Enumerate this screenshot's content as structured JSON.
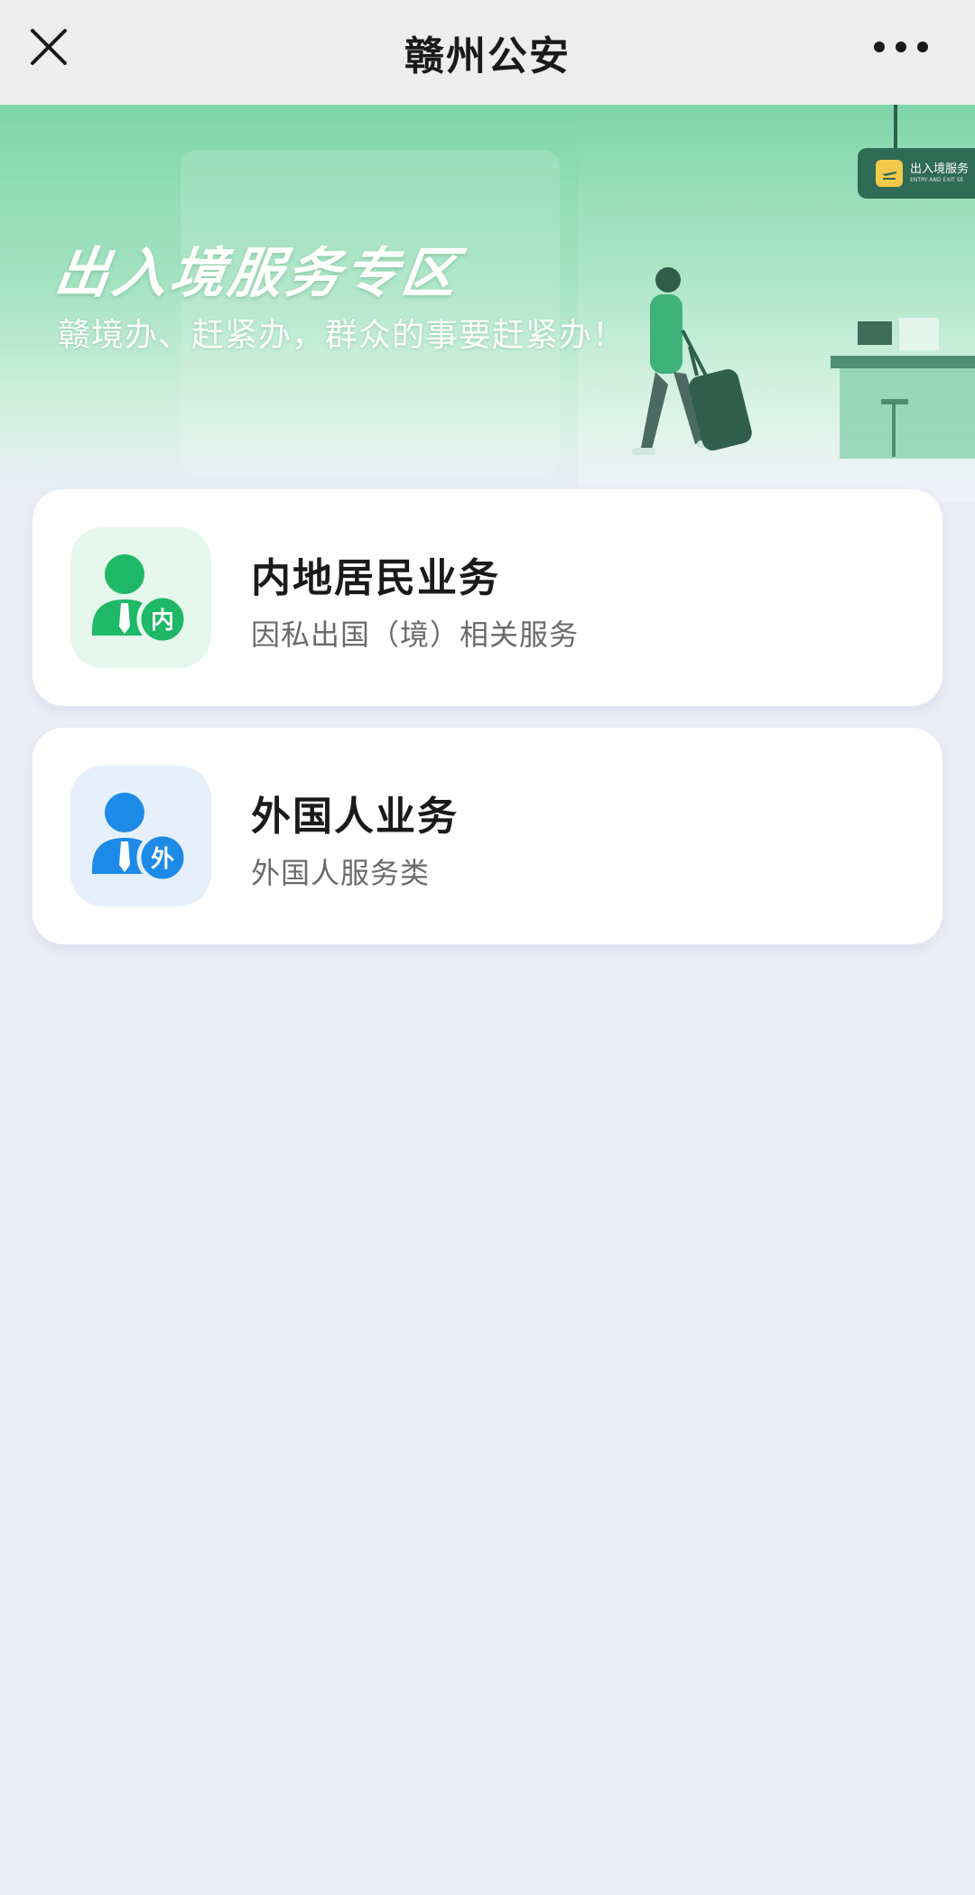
{
  "navbar": {
    "title": "赣州公安",
    "close_icon": "close-icon",
    "more_icon": "more-icon"
  },
  "banner": {
    "title": "出入境服务专区",
    "subtitle": "赣境办、赶紧办，群众的事要赶紧办！",
    "sign": {
      "label_cn": "出入境服务",
      "label_en": "ENTRY AND EXIT SE"
    }
  },
  "services": [
    {
      "title": "内地居民业务",
      "description": "因私出国（境）相关服务",
      "badge": "内",
      "icon": "user-badge-icon",
      "color": "#1fb866",
      "bg": "#e6f8ee"
    },
    {
      "title": "外国人业务",
      "description": "外国人服务类",
      "badge": "外",
      "icon": "user-badge-icon",
      "color": "#1e8ae8",
      "bg": "#e6f0fc"
    }
  ],
  "colors": {
    "background": "#ecedf8",
    "navbar": "#ededed",
    "banner": "#7fd6a8"
  }
}
